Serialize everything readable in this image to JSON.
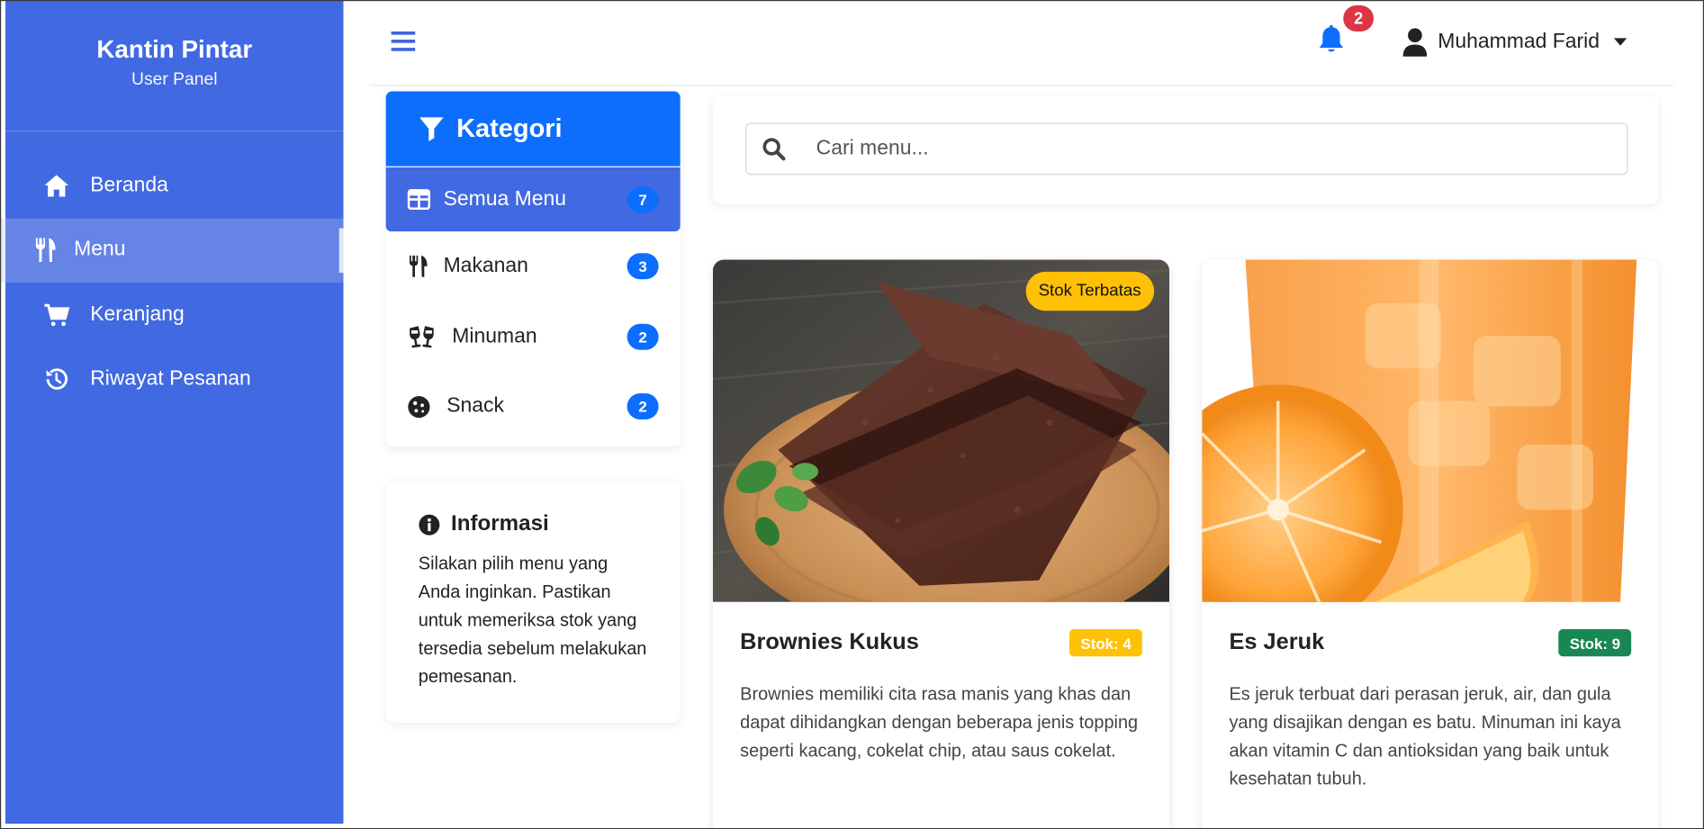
{
  "sidebar": {
    "brand_title": "Kantin Pintar",
    "brand_subtitle": "User Panel",
    "items": [
      {
        "label": "Beranda",
        "icon": "home-icon",
        "active": false
      },
      {
        "label": "Menu",
        "icon": "utensils-icon",
        "active": true
      },
      {
        "label": "Keranjang",
        "icon": "cart-icon",
        "active": false
      },
      {
        "label": "Riwayat Pesanan",
        "icon": "history-icon",
        "active": false
      }
    ],
    "color": "#4169e1"
  },
  "topbar": {
    "notification_count": "2",
    "user_name": "Muhammad Farid"
  },
  "categories": {
    "title": "Kategori",
    "items": [
      {
        "label": "Semua Menu",
        "count": "7",
        "icon": "grid-icon",
        "active": true
      },
      {
        "label": "Makanan",
        "count": "3",
        "icon": "utensils-icon",
        "active": false
      },
      {
        "label": "Minuman",
        "count": "2",
        "icon": "glasses-icon",
        "active": false
      },
      {
        "label": "Snack",
        "count": "2",
        "icon": "cookie-icon",
        "active": false
      }
    ]
  },
  "info": {
    "title": "Informasi",
    "text": "Silakan pilih menu yang Anda inginkan. Pastikan untuk memeriksa stok yang tersedia sebelum melakukan pemesanan."
  },
  "search": {
    "placeholder": "Cari menu..."
  },
  "products": [
    {
      "name": "Brownies Kukus",
      "stock_label": "Stok: 4",
      "stock_color": "#ffc107",
      "badge": "Stok Terbatas",
      "description": "Brownies memiliki cita rasa manis yang khas dan dapat dihidangkan dengan beberapa jenis topping seperti kacang, cokelat chip, atau saus cokelat."
    },
    {
      "name": "Es Jeruk",
      "stock_label": "Stok: 9",
      "stock_color": "#198754",
      "description": "Es jeruk terbuat dari perasan jeruk, air, dan gula yang disajikan dengan es batu. Minuman ini kaya akan vitamin C dan antioksidan yang baik untuk kesehatan tubuh."
    }
  ]
}
